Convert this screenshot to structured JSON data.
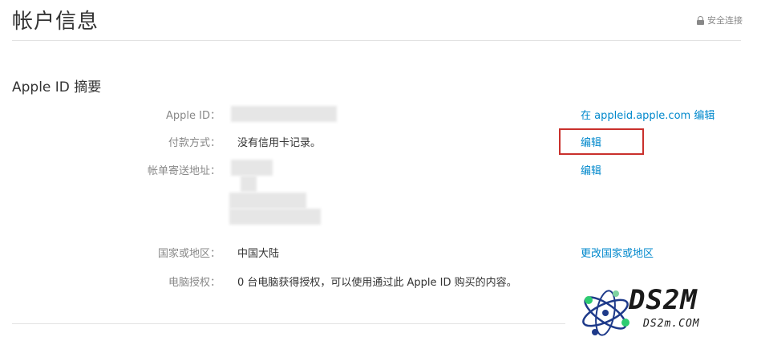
{
  "header": {
    "title": "帐户信息",
    "secure_label": "安全连接"
  },
  "summary": {
    "title": "Apple ID 摘要",
    "rows": [
      {
        "label": "Apple ID：",
        "value": "",
        "action": "在 appleid.apple.com 编辑"
      },
      {
        "label": "付款方式：",
        "value": "没有信用卡记录。",
        "action": "编辑"
      },
      {
        "label": "帐单寄送地址：",
        "value": "",
        "action": "编辑"
      },
      {
        "label": "国家或地区：",
        "value": "中国大陆",
        "action": "更改国家或地区"
      },
      {
        "label": "电脑授权：",
        "value": "0 台电脑获得授权，可以使用通过此 Apple ID 购买的内容。",
        "action": ""
      }
    ]
  },
  "watermark": {
    "main": "DS2M",
    "sub": "DS2m.COM"
  },
  "colors": {
    "link": "#0088cc",
    "highlight": "#c9302c",
    "label": "#888888"
  }
}
